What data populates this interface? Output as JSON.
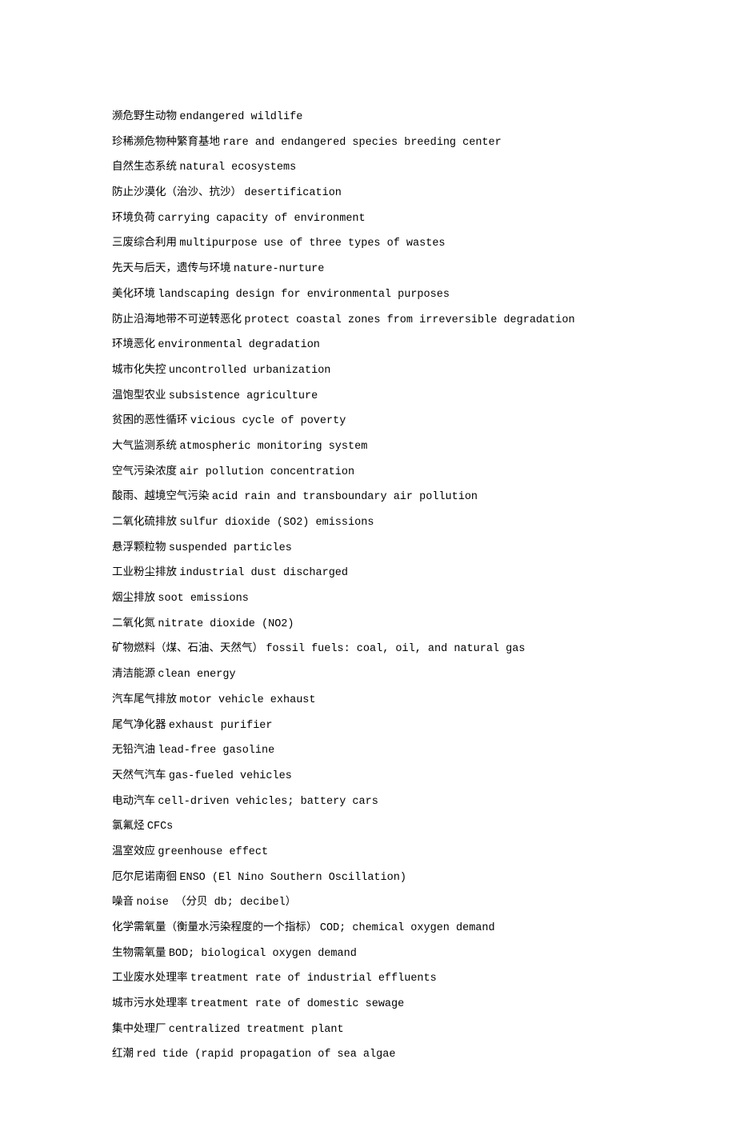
{
  "entries": [
    {
      "zh": "濒危野生动物",
      "en": "endangered wildlife"
    },
    {
      "zh": "珍稀濒危物种繁育基地",
      "en": "rare and endangered species breeding center"
    },
    {
      "zh": "自然生态系统",
      "en": "natural ecosystems"
    },
    {
      "zh": "防止沙漠化（治沙、抗沙）",
      "en": " desertification"
    },
    {
      "zh": "环境负荷",
      "en": "carrying capacity of environment"
    },
    {
      "zh": "三废综合利用",
      "en": "multipurpose use of three types of wastes"
    },
    {
      "zh": "先天与后天，遗传与环境",
      "en": "nature-nurture"
    },
    {
      "zh": "美化环境",
      "en": "landscaping design for environmental purposes"
    },
    {
      "zh": "防止沿海地带不可逆转恶化",
      "en": "protect coastal zones from irreversible degradation"
    },
    {
      "zh": "环境恶化",
      "en": "environmental degradation"
    },
    {
      "zh": "城市化失控",
      "en": "uncontrolled urbanization"
    },
    {
      "zh": "温饱型农业",
      "en": "subsistence agriculture"
    },
    {
      "zh": "贫困的恶性循环",
      "en": "vicious cycle of poverty"
    },
    {
      "zh": "大气监测系统",
      "en": "atmospheric monitoring system"
    },
    {
      "zh": "空气污染浓度",
      "en": "air pollution concentration"
    },
    {
      "zh": "酸雨、越境空气污染",
      "en": "acid rain and transboundary air pollution"
    },
    {
      "zh": "二氧化硫排放",
      "en": "sulfur dioxide (SO2) emissions"
    },
    {
      "zh": "悬浮颗粒物",
      "en": "suspended particles"
    },
    {
      "zh": "工业粉尘排放",
      "en": "industrial dust discharged"
    },
    {
      "zh": "烟尘排放",
      "en": "soot emissions"
    },
    {
      "zh": "二氧化氮",
      "en": "nitrate dioxide (NO2)"
    },
    {
      "zh": "矿物燃料（煤、石油、天然气）",
      "en": " fossil fuels: coal, oil, and natural gas"
    },
    {
      "zh": "清洁能源",
      "en": "clean energy"
    },
    {
      "zh": "汽车尾气排放",
      "en": "motor vehicle exhaust"
    },
    {
      "zh": "尾气净化器",
      "en": "exhaust purifier"
    },
    {
      "zh": "无铅汽油",
      "en": "lead-free gasoline"
    },
    {
      "zh": "天然气汽车",
      "en": "gas-fueled vehicles"
    },
    {
      "zh": "电动汽车",
      "en": "cell-driven vehicles; battery cars"
    },
    {
      "zh": "氯氟烃",
      "en": "CFCs"
    },
    {
      "zh": "温室效应",
      "en": "greenhouse effect"
    },
    {
      "zh": "厄尔尼诺南徊",
      "en": "ENSO (El Nino Southern Oscillation)"
    },
    {
      "zh": "噪音",
      "en": "noise （分贝 db; decibel）"
    },
    {
      "zh": "化学需氧量（衡量水污染程度的一个指标）",
      "en": " COD; chemical oxygen demand"
    },
    {
      "zh": "生物需氧量",
      "en": "BOD; biological oxygen demand"
    },
    {
      "zh": "工业废水处理率",
      "en": "treatment rate of industrial effluents"
    },
    {
      "zh": "城市污水处理率",
      "en": "treatment rate of domestic sewage"
    },
    {
      "zh": "集中处理厂",
      "en": "centralized treatment plant"
    },
    {
      "zh": "红潮",
      "en": "red tide (rapid propagation of sea algae"
    }
  ]
}
